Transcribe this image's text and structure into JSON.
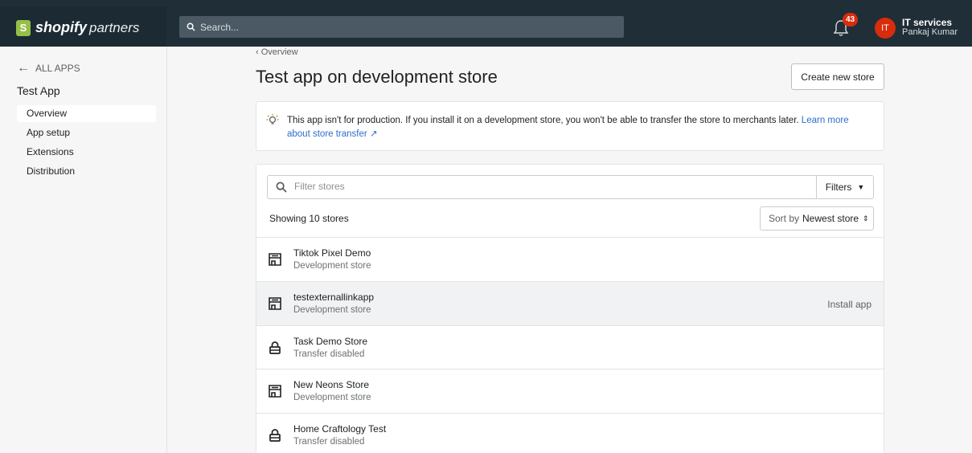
{
  "topbar": {
    "logo_mark": "S",
    "logo_word": "shopify",
    "logo_sub": "partners",
    "search_placeholder": "Search...",
    "notification_count": "43",
    "avatar_initials": "IT",
    "user_name": "IT services",
    "user_sub": "Pankaj Kumar"
  },
  "sidebar": {
    "back_label": "ALL APPS",
    "app_title": "Test App",
    "items": [
      {
        "label": "Overview",
        "active": true
      },
      {
        "label": "App setup",
        "active": false
      },
      {
        "label": "Extensions",
        "active": false
      },
      {
        "label": "Distribution",
        "active": false
      }
    ]
  },
  "main": {
    "breadcrumb": "Overview",
    "title": "Test app on development store",
    "create_button": "Create new store",
    "banner_text": "This app isn't for production. If you install it on a development store, you won't be able to transfer the store to merchants later.",
    "banner_link": "Learn more about store transfer",
    "filter_placeholder": "Filter stores",
    "filters_label": "Filters",
    "showing_text": "Showing 10 stores",
    "sort_prefix": "Sort by",
    "sort_value": "Newest store",
    "stores": [
      {
        "name": "Tiktok Pixel Demo",
        "sub": "Development store",
        "icon": "store-icon",
        "action": ""
      },
      {
        "name": "testexternallinkapp",
        "sub": "Development store",
        "icon": "store-icon",
        "action": "Install app"
      },
      {
        "name": "Task Demo Store",
        "sub": "Transfer disabled",
        "icon": "lock-icon",
        "action": ""
      },
      {
        "name": "New Neons Store",
        "sub": "Development store",
        "icon": "store-icon",
        "action": ""
      },
      {
        "name": "Home Craftology Test",
        "sub": "Transfer disabled",
        "icon": "lock-icon",
        "action": ""
      }
    ]
  },
  "colors": {
    "topbar": "#202e37",
    "brand_green": "#95bf47",
    "badge_red": "#d82c0d",
    "link_blue": "#2c6ecb"
  }
}
